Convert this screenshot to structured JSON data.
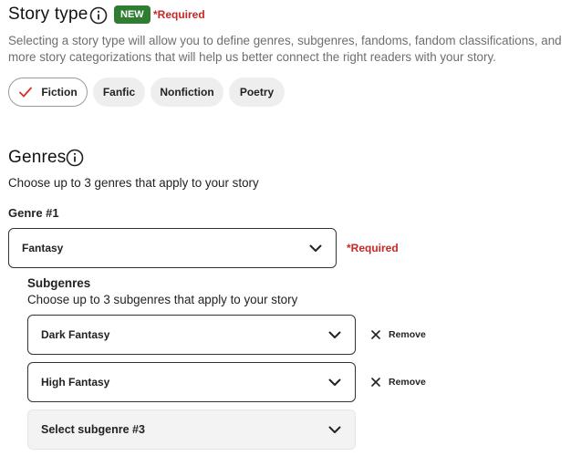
{
  "story_type": {
    "title": "Story type",
    "badge": "NEW",
    "required": "*Required",
    "description_line1": "Selecting a story type will allow you to define genres, subgenres, fandoms, fandom classifications, and",
    "description_line2": "more story categorizations that will help us better connect the right readers with your story.",
    "options": [
      {
        "label": "Fiction",
        "selected": true
      },
      {
        "label": "Fanfic",
        "selected": false
      },
      {
        "label": "Nonfiction",
        "selected": false
      },
      {
        "label": "Poetry",
        "selected": false
      }
    ]
  },
  "genres": {
    "title": "Genres",
    "description": "Choose up to 3 genres that apply to your story",
    "genre1_label": "Genre #1",
    "genre1_value": "Fantasy",
    "genre1_required": "*Required",
    "subgenres": {
      "title": "Subgenres",
      "description": "Choose up to 3 subgenres that apply to your story",
      "items": [
        {
          "value": "Dark Fantasy",
          "remove_label": "Remove"
        },
        {
          "value": "High Fantasy",
          "remove_label": "Remove"
        }
      ],
      "placeholder": "Select subgenre #3"
    }
  },
  "colors": {
    "badge_green": "#2e7d32",
    "required_red": "#c62828",
    "check_red": "#d32f2f"
  },
  "icons": [
    "info-icon",
    "check-icon",
    "chevron-down-icon",
    "close-icon"
  ]
}
